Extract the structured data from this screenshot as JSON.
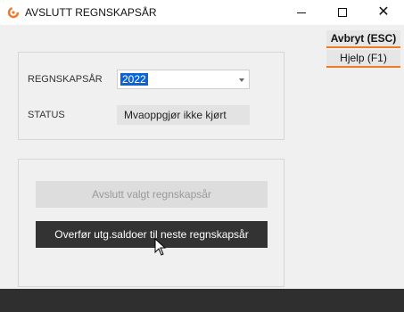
{
  "window": {
    "title": "AVSLUTT REGNSKAPSÅR",
    "icons": {
      "app": "app-logo-icon",
      "minimize": "minimize-icon",
      "maximize": "maximize-icon",
      "close": "close-icon"
    },
    "close_glyph": "✕"
  },
  "side_buttons": {
    "cancel": "Avbryt (ESC)",
    "help": "Hjelp (F1)"
  },
  "form": {
    "year_label": "REGNSKAPSÅR",
    "year_value": "2022",
    "status_label": "STATUS",
    "status_value": "Mvaoppgjør ikke kjørt"
  },
  "actions": {
    "finish_label": "Avslutt valgt regnskapsår",
    "finish_enabled": false,
    "transfer_label": "Overfør utg.saldoer til neste regnskapsår"
  },
  "colors": {
    "accent": "#f07a2a",
    "selection": "#0a64d6",
    "dark_button": "#333333",
    "footer": "#2f2f2f"
  }
}
